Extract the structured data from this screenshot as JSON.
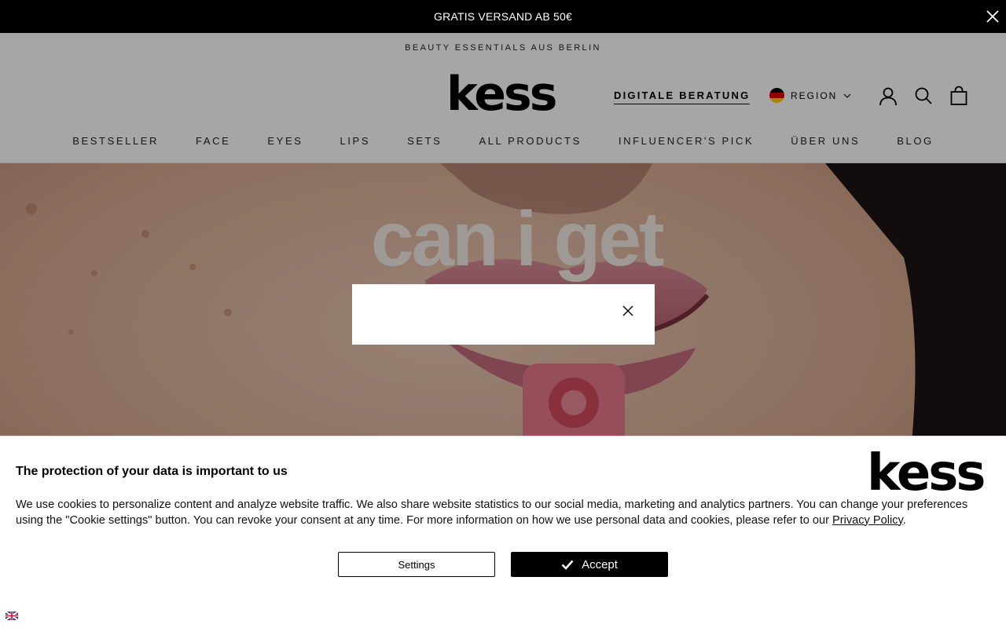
{
  "announcement": {
    "text": "GRATIS VERSAND AB 50€"
  },
  "header": {
    "tagline": "BEAUTY ESSENTIALS AUS BERLIN",
    "logo_text": "kess",
    "consult_link": "DIGITALE BERATUNG",
    "region_label": "REGION"
  },
  "nav": {
    "items": [
      {
        "label": "BESTSELLER"
      },
      {
        "label": "FACE"
      },
      {
        "label": "EYES"
      },
      {
        "label": "LIPS"
      },
      {
        "label": "SETS"
      },
      {
        "label": "ALL PRODUCTS"
      },
      {
        "label": "INFLUENCER'S PICK"
      },
      {
        "label": "ÜBER UNS"
      },
      {
        "label": "BLOG"
      }
    ]
  },
  "hero": {
    "headline": "can i get"
  },
  "cookie": {
    "title": "The protection of your data is important to us",
    "logo_text": "kess",
    "body": "We use cookies to personalize content and analyze website traffic. We also share website statistics to our social media, marketing and analytics partners. You can change your preferences using the \"Cookie settings\" button. You can revoke your consent at any time. For more information on how we use personal data and cookies, please refer to our ",
    "link": "Privacy Policy",
    "after_link": ".",
    "settings_label": "Settings",
    "accept_label": "Accept"
  },
  "colors": {
    "announcement_bg": "#000000",
    "accept_bg": "#000000",
    "overlay": "rgba(0,0,0,0.35)"
  },
  "icons": [
    "close-icon",
    "chevron-down-icon",
    "account-icon",
    "search-icon",
    "cart-icon",
    "checkmark-icon",
    "language-flag-icon"
  ]
}
